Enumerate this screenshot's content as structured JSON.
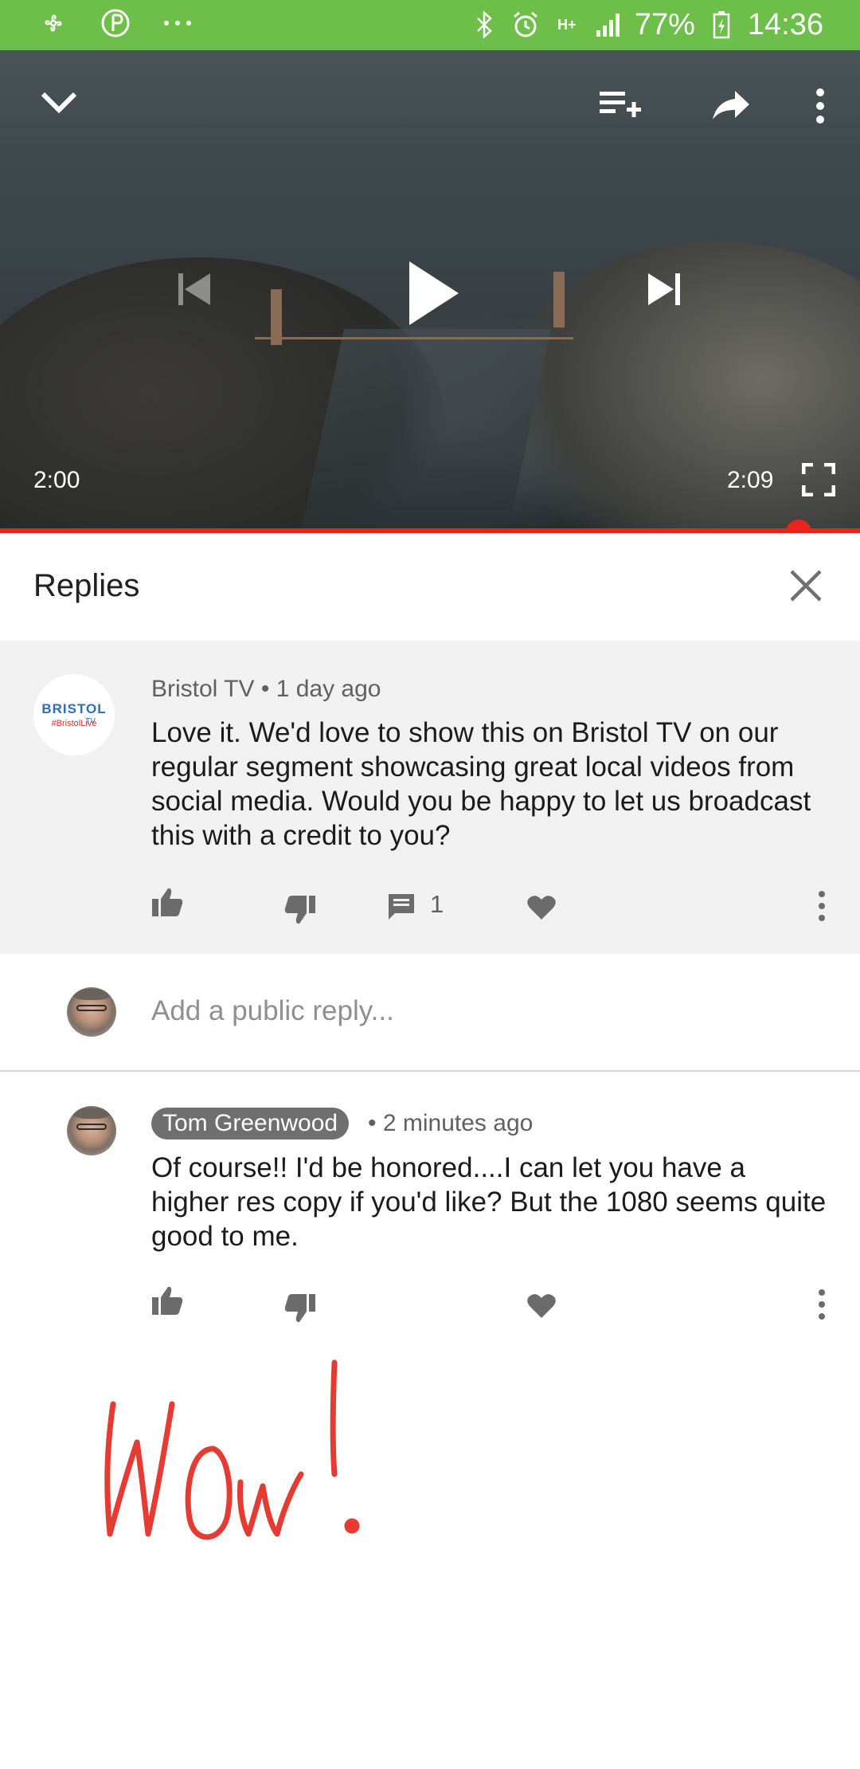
{
  "status_bar": {
    "battery": "77%",
    "time": "14:36",
    "network": "H+"
  },
  "player": {
    "current_time": "2:00",
    "duration": "2:09",
    "progress_fraction": 0.93
  },
  "replies_panel": {
    "title": "Replies"
  },
  "parent_comment": {
    "author": "Bristol TV",
    "separator": "•",
    "time_ago": "1 day ago",
    "text": "Love it. We'd love to show this on Bristol TV on our regular segment showcasing great local videos from social media. Would you be happy to let us broadcast this with a credit to you?",
    "reply_count": "1",
    "avatar_logo": "BRISTOL",
    "avatar_tv": "TV",
    "avatar_tag": "#BristolLive"
  },
  "add_reply": {
    "placeholder": "Add a public reply..."
  },
  "reply_comment": {
    "author": "Tom Greenwood",
    "separator": "•",
    "time_ago": "2 minutes ago",
    "text": "Of course!! I'd be honored....I can let you have a higher res copy if you'd like? But the 1080 seems quite good to me."
  },
  "annotation": {
    "handwritten_text": "Wow!",
    "color": "#e53b32"
  },
  "colors": {
    "status_bar": "#6dbf4a",
    "progress": "#e52420",
    "parent_bg": "#f1f1f1"
  }
}
